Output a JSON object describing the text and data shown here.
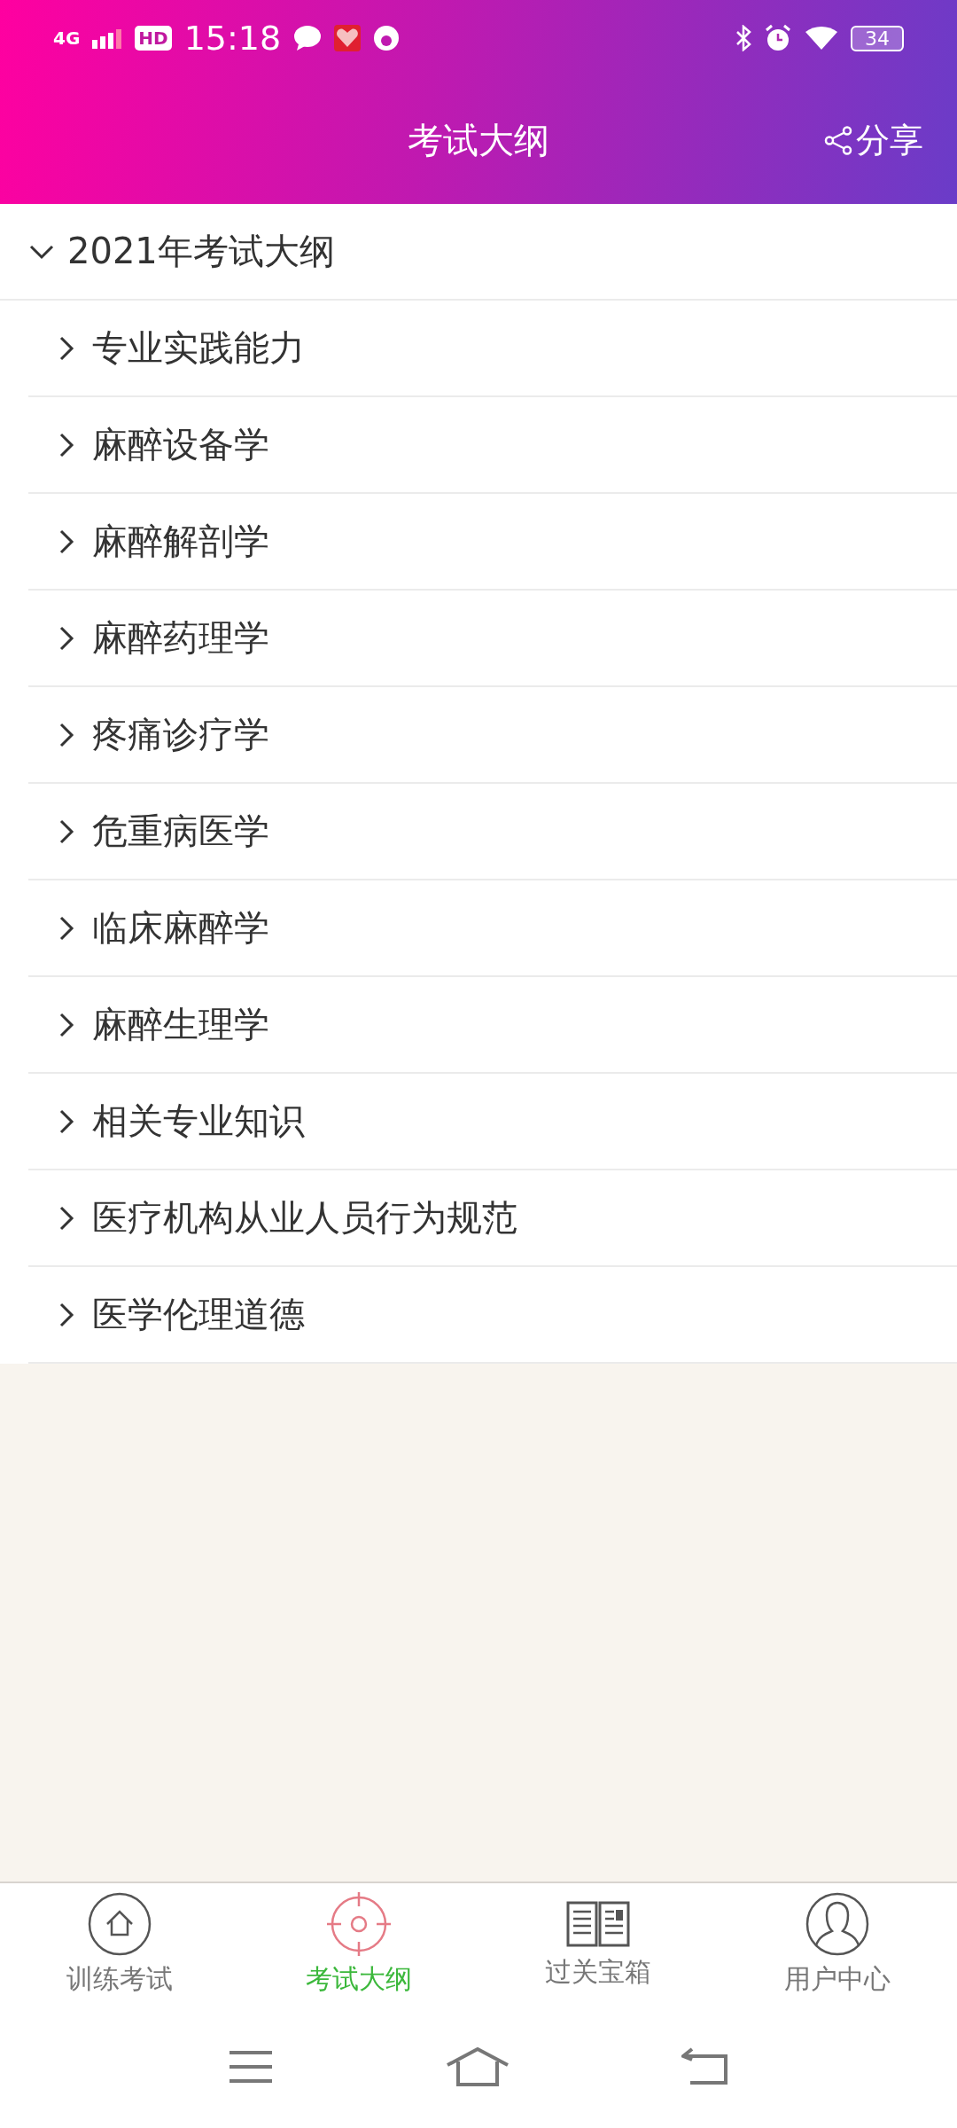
{
  "status_bar": {
    "network": "4G",
    "hd": "HD",
    "time": "15:18",
    "battery": "34"
  },
  "header": {
    "title": "考试大纲",
    "share": "分享"
  },
  "outline": {
    "label": "2021年考试大纲",
    "expanded": true,
    "children": [
      {
        "label": "专业实践能力",
        "expanded": false
      },
      {
        "label": "麻醉设备学",
        "expanded": false
      },
      {
        "label": "麻醉解剖学",
        "expanded": false
      },
      {
        "label": "麻醉药理学",
        "expanded": false
      },
      {
        "label": "疼痛诊疗学",
        "expanded": false
      },
      {
        "label": "危重病医学",
        "expanded": false
      },
      {
        "label": "临床麻醉学",
        "expanded": false
      },
      {
        "label": "麻醉生理学",
        "expanded": false
      },
      {
        "label": "相关专业知识",
        "expanded": false
      },
      {
        "label": "医疗机构从业人员行为规范",
        "expanded": false
      },
      {
        "label": "医学伦理道德",
        "expanded": false
      }
    ]
  },
  "tabs": [
    {
      "label": "训练考试",
      "kind": "home",
      "selected": false
    },
    {
      "label": "考试大纲",
      "kind": "target",
      "selected": true
    },
    {
      "label": "过关宝箱",
      "kind": "book",
      "selected": false
    },
    {
      "label": "用户中心",
      "kind": "user",
      "selected": false
    }
  ]
}
